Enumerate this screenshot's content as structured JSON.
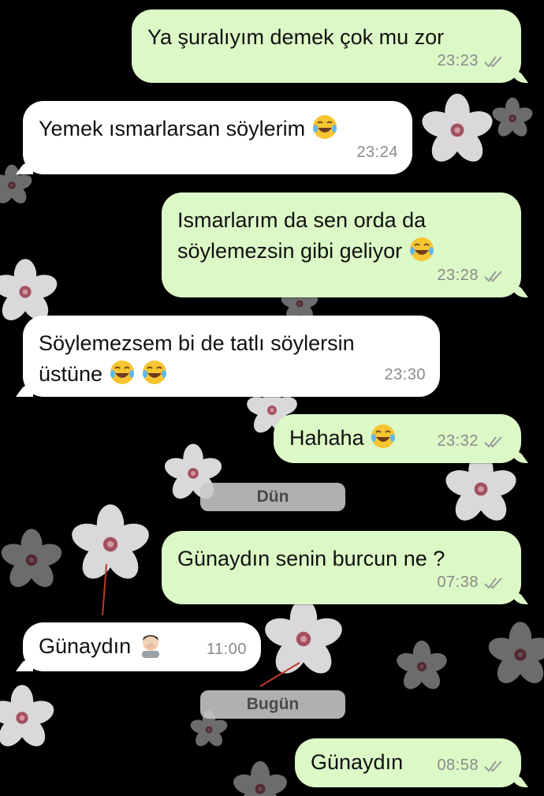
{
  "messages": [
    {
      "text": "Ya şuralıyım demek çok mu zor",
      "time": "23:23",
      "dir": "out",
      "emoji": "",
      "status": "read"
    },
    {
      "text": "Yemek ısmarlarsan söylerim",
      "time": "23:24",
      "dir": "in",
      "emoji": "laughing-tears"
    },
    {
      "text_line1": "Ismarlarım da sen orda da",
      "text_line2": "söylemezsin gibi geliyor",
      "time": "23:28",
      "dir": "out",
      "emoji": "laughing-tears",
      "status": "read"
    },
    {
      "text_line1": "Söylemezsem bi de tatlı söylersin",
      "text_line2": "üstüne",
      "time": "23:30",
      "dir": "in",
      "emoji": "laughing-tears x2"
    },
    {
      "text": "Hahaha",
      "time": "23:32",
      "dir": "out",
      "emoji": "laughing-tears",
      "status": "read"
    },
    {
      "text": "Günaydın senin burcun ne ?",
      "time": "07:38",
      "dir": "out",
      "status": "read"
    },
    {
      "text": "Günaydın",
      "time": "11:00",
      "dir": "in",
      "emoji": "facepalm"
    },
    {
      "text": "Günaydın",
      "time": "08:58",
      "dir": "out",
      "status": "read"
    }
  ],
  "date_separators": {
    "yesterday": "Dün",
    "today": "Bugün"
  },
  "colors": {
    "outgoing": "#dcf8c6",
    "incoming": "#ffffff",
    "background": "#000000",
    "meta": "#8a8a8a"
  }
}
